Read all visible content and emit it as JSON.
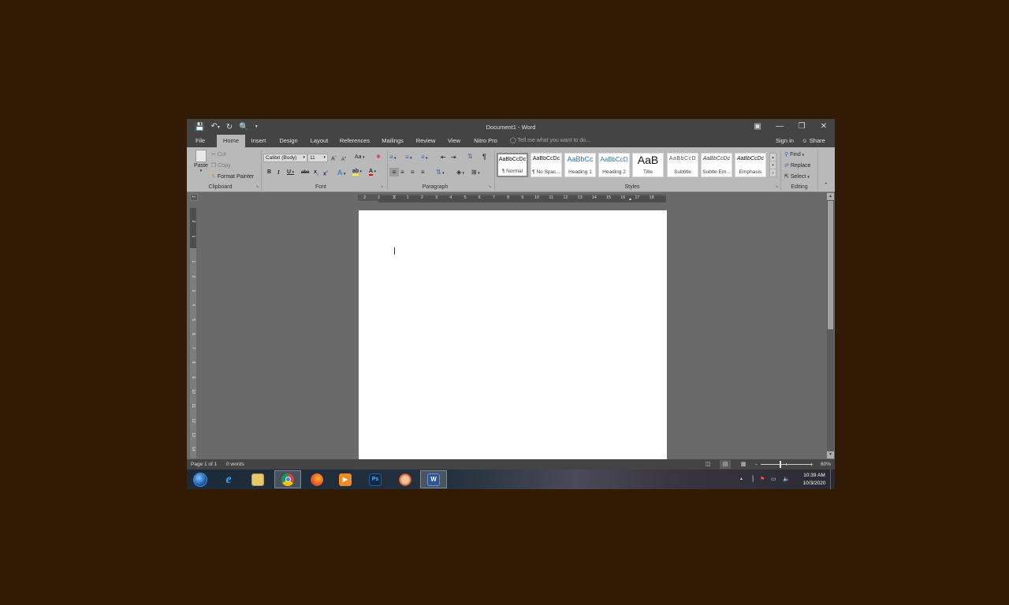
{
  "window": {
    "title": "Document1 - Word",
    "qat": [
      "save-icon",
      "undo-icon",
      "redo-icon",
      "print-preview-icon",
      "customize-qat-icon"
    ],
    "controls": [
      "ribbon-display-options",
      "minimize",
      "restore",
      "close"
    ]
  },
  "tabs": [
    {
      "label": "File",
      "active": false
    },
    {
      "label": "Home",
      "active": true
    },
    {
      "label": "Insert",
      "active": false
    },
    {
      "label": "Design",
      "active": false
    },
    {
      "label": "Layout",
      "active": false
    },
    {
      "label": "References",
      "active": false
    },
    {
      "label": "Mailings",
      "active": false
    },
    {
      "label": "Review",
      "active": false
    },
    {
      "label": "View",
      "active": false
    },
    {
      "label": "Nitro Pro",
      "active": false
    }
  ],
  "tellme": {
    "placeholder": "Tell me what you want to do..."
  },
  "account": {
    "signin": "Sign in",
    "share": "Share"
  },
  "ribbon": {
    "clipboard": {
      "label": "Clipboard",
      "paste": "Paste",
      "cut": "Cut",
      "copy": "Copy",
      "format_painter": "Format Painter"
    },
    "font": {
      "label": "Font",
      "font_name": "Calibri (Body)",
      "font_size": "11",
      "grow": "A",
      "shrink": "A",
      "change_case": "Aa",
      "bold": "B",
      "italic": "I",
      "underline": "U",
      "strikethrough": "abc",
      "subscript": "x",
      "superscript": "x",
      "highlight_color": "#ffff00",
      "font_color": "#e00000"
    },
    "paragraph": {
      "label": "Paragraph"
    },
    "styles": {
      "label": "Styles",
      "items": [
        {
          "sample": "AaBbCcDc",
          "name": "¶ Normal",
          "selected": true
        },
        {
          "sample": "AaBbCcDc",
          "name": "¶ No Spac...",
          "selected": false
        },
        {
          "sample": "AaBbCc",
          "name": "Heading 1",
          "selected": false
        },
        {
          "sample": "AaBbCcD",
          "name": "Heading 2",
          "selected": false
        },
        {
          "sample": "AaB",
          "name": "Title",
          "selected": false
        },
        {
          "sample": "AaBbCcD",
          "name": "Subtitle",
          "selected": false
        },
        {
          "sample": "AaBbCcDc",
          "name": "Subtle Em...",
          "selected": false
        },
        {
          "sample": "AaBbCcDc",
          "name": "Emphasis",
          "selected": false
        }
      ]
    },
    "editing": {
      "label": "Editing",
      "find": "Find",
      "replace": "Replace",
      "select": "Select"
    }
  },
  "ruler": {
    "horizontal_ticks": [
      "2",
      "1",
      "1",
      "2",
      "3",
      "4",
      "5",
      "6",
      "7",
      "8",
      "9",
      "10",
      "11",
      "12",
      "13",
      "14",
      "15",
      "16",
      "17",
      "18"
    ],
    "vertical_ticks": [
      "2",
      "1",
      "1",
      "2",
      "3",
      "4",
      "5",
      "6",
      "7",
      "8",
      "9",
      "10",
      "11",
      "12",
      "13",
      "14"
    ]
  },
  "document": {
    "content": ""
  },
  "statusbar": {
    "page": "Page 1 of 1",
    "words": "0 words",
    "zoom_minus": "-",
    "zoom_plus": "+",
    "zoom_level": "80%",
    "zoom_percent": 80
  },
  "taskbar": {
    "apps": [
      {
        "name": "Start",
        "active": false
      },
      {
        "name": "Internet Explorer",
        "active": false
      },
      {
        "name": "File Explorer",
        "active": false
      },
      {
        "name": "Google Chrome",
        "active": true
      },
      {
        "name": "Firefox",
        "active": false
      },
      {
        "name": "Media Player",
        "active": false
      },
      {
        "name": "Photoshop",
        "label": "Ps",
        "active": false
      },
      {
        "name": "Game",
        "active": false
      },
      {
        "name": "Word",
        "label": "W",
        "active": true
      }
    ],
    "clock": {
      "time": "10:39 AM",
      "date": "10/3/2020"
    }
  }
}
